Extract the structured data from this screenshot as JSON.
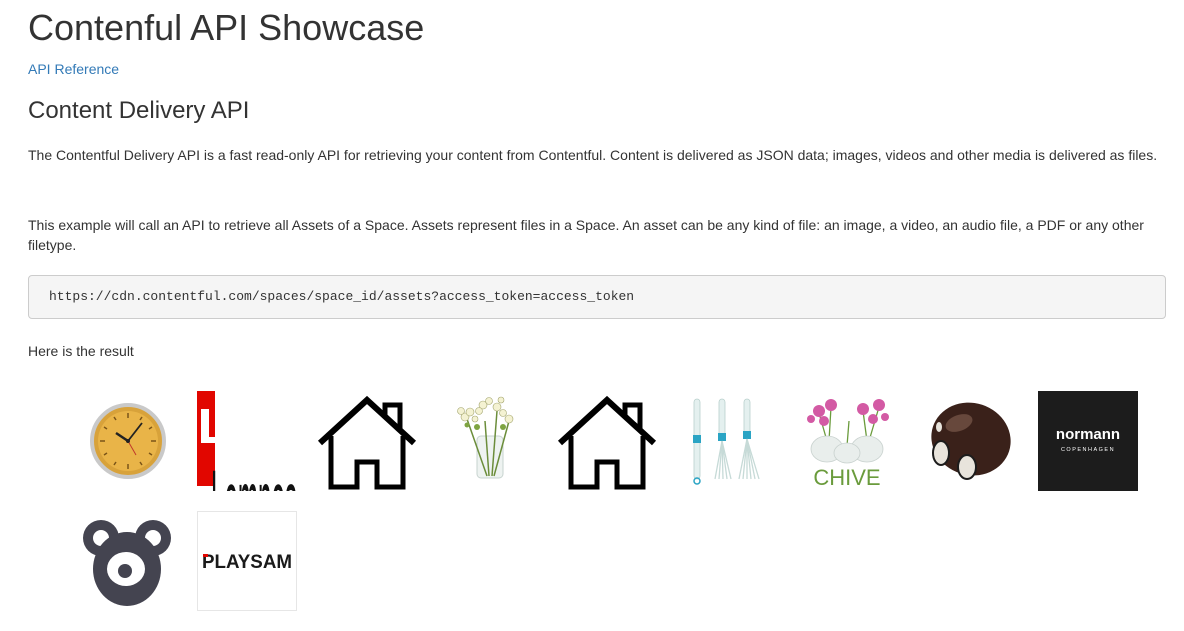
{
  "page": {
    "title": "Contenful API Showcase",
    "api_reference_link": "API Reference"
  },
  "section": {
    "title": "Content Delivery API",
    "paragraph1": "The Contentful Delivery API is a fast read-only API for retrieving your content from Contentful. Content is delivered as JSON data; images, videos and other media is delivered as files.",
    "paragraph2": "This example will call an API to retrieve all Assets of a Space. Assets represent files in a Space. An asset can be any kind of file: an image, a video, an audio file, a PDF or any other filetype.",
    "code_url": "https://cdn.contentful.com/spaces/space_id/assets?access_token=access_token",
    "result_label": "Here is the result"
  },
  "assets": [
    {
      "icon": "wall-clock-image"
    },
    {
      "icon": "lemnos-logo",
      "text": "Lemnos"
    },
    {
      "icon": "house-icon"
    },
    {
      "icon": "flower-vase-image"
    },
    {
      "icon": "house-icon"
    },
    {
      "icon": "brushes-image"
    },
    {
      "icon": "chive-vases-image",
      "text": "CHIVE"
    },
    {
      "icon": "toy-car-image"
    },
    {
      "icon": "normann-logo",
      "text": "normann",
      "subtext": "COPENHAGEN"
    },
    {
      "icon": "bear-icon"
    },
    {
      "icon": "playsam-logo",
      "text": "PLAYSAM"
    }
  ],
  "colors": {
    "link": "#337ab7",
    "text": "#333333",
    "code_bg": "#f5f5f5"
  }
}
